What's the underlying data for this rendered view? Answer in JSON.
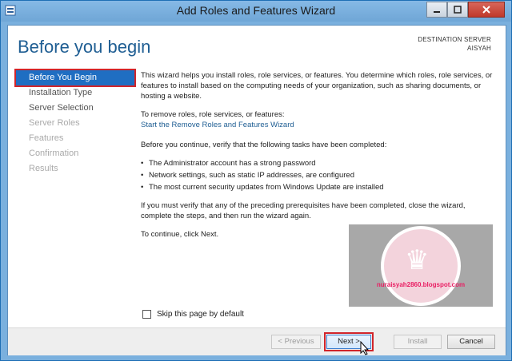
{
  "window": {
    "title": "Add Roles and Features Wizard"
  },
  "header": {
    "page_title": "Before you begin",
    "destination_label": "DESTINATION SERVER",
    "destination_server": "AISYAH"
  },
  "nav": {
    "items": [
      {
        "label": "Before You Begin",
        "state": "active"
      },
      {
        "label": "Installation Type",
        "state": "enabled"
      },
      {
        "label": "Server Selection",
        "state": "enabled"
      },
      {
        "label": "Server Roles",
        "state": "disabled"
      },
      {
        "label": "Features",
        "state": "disabled"
      },
      {
        "label": "Confirmation",
        "state": "disabled"
      },
      {
        "label": "Results",
        "state": "disabled"
      }
    ]
  },
  "content": {
    "intro": "This wizard helps you install roles, role services, or features. You determine which roles, role services, or features to install based on the computing needs of your organization, such as sharing documents, or hosting a website.",
    "remove_heading": "To remove roles, role services, or features:",
    "remove_link": "Start the Remove Roles and Features Wizard",
    "verify_intro": "Before you continue, verify that the following tasks have been completed:",
    "tasks": [
      "The Administrator account has a strong password",
      "Network settings, such as static IP addresses, are configured",
      "The most current security updates from Windows Update are installed"
    ],
    "prereq_note": "If you must verify that any of the preceding prerequisites have been completed, close the wizard, complete the steps, and then run the wizard again.",
    "continue_note": "To continue, click Next.",
    "skip_label": "Skip this page by default",
    "skip_checked": false
  },
  "watermark": {
    "text": "nuraisyah2860.blogspot.com"
  },
  "footer": {
    "previous": "< Previous",
    "next": "Next >",
    "install": "Install",
    "cancel": "Cancel"
  },
  "colors": {
    "accent": "#1f6ec2",
    "highlight_border": "#d1252b",
    "title_bar": "#7ab0de",
    "header_text": "#1f5e93"
  }
}
